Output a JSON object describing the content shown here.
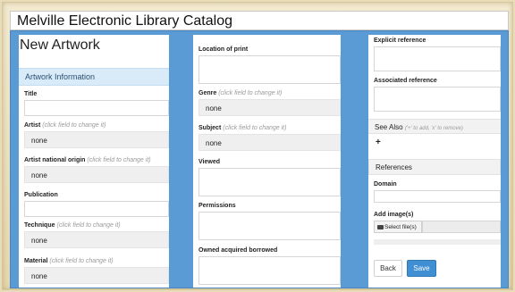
{
  "app": {
    "title": "Melville Electronic Library Catalog"
  },
  "col1": {
    "page_title": "New Artwork",
    "section_title": "Artwork Information",
    "title_label": "Title",
    "artist_label": "Artist",
    "artist_hint": "(click field to change it)",
    "artist_value": "none",
    "origin_label": "Artist national origin",
    "origin_hint": "(click field to change it)",
    "origin_value": "none",
    "publication_label": "Publication",
    "technique_label": "Technique",
    "technique_hint": "(click field to change it)",
    "technique_value": "none",
    "material_label": "Material",
    "material_hint": "(click field to change it)",
    "material_value": "none"
  },
  "col2": {
    "location_label": "Location of print",
    "genre_label": "Genre",
    "genre_hint": "(click field to change it)",
    "genre_value": "none",
    "subject_label": "Subject",
    "subject_hint": "(click field to change it)",
    "subject_value": "none",
    "viewed_label": "Viewed",
    "permissions_label": "Permissions",
    "owned_label": "Owned acquired borrowed"
  },
  "col3": {
    "explicit_label": "Explicit reference",
    "associated_label": "Associated reference",
    "see_also_label": "See Also",
    "see_also_hint": "('+' to add, 'x' to remove)",
    "add_symbol": "+",
    "references_label": "References",
    "domain_label": "Domain",
    "add_images_label": "Add image(s)",
    "select_files_label": "Select file(s)",
    "back_label": "Back",
    "save_label": "Save"
  },
  "icons": [
    "folder-icon",
    "plus-icon"
  ],
  "colors": {
    "stage_blue": "#5b9bd5",
    "save_blue": "#3f8fd2",
    "section_bg": "#d9ebf8"
  }
}
